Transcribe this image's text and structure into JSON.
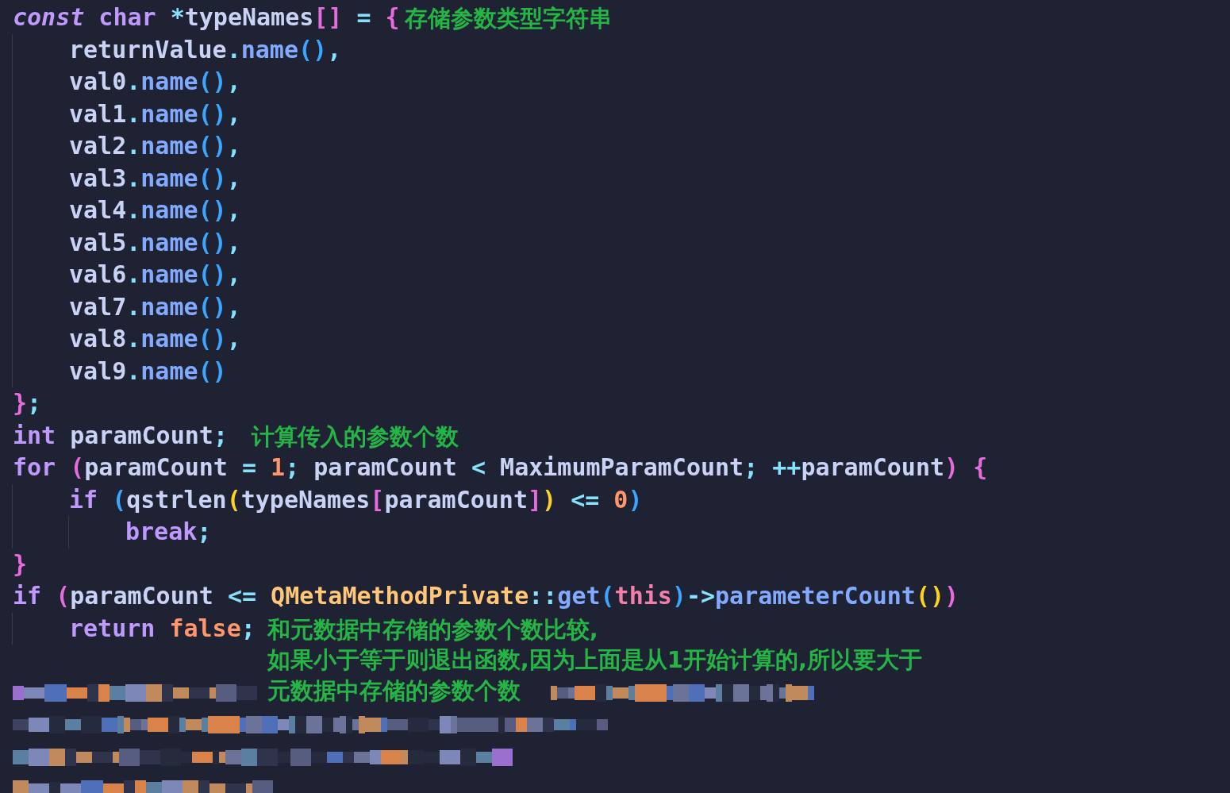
{
  "editor": {
    "lines": [
      {
        "tokens": [
          {
            "kind": "storage",
            "text": "const"
          },
          {
            "kind": "keyword",
            "text": " char"
          },
          {
            "kind": "op",
            "text": " *"
          },
          {
            "kind": "plain",
            "text": "typeNames"
          },
          {
            "kind": "bracket1",
            "text": "[]"
          },
          {
            "kind": "op",
            "text": " ="
          },
          {
            "kind": "bracket1",
            "text": " {"
          }
        ],
        "note": [
          "存储参数类型字符串"
        ],
        "children": [
          {
            "tokens": [
              {
                "kind": "plain",
                "text": "returnValue"
              },
              {
                "kind": "op",
                "text": "."
              },
              {
                "kind": "func",
                "text": "name"
              },
              {
                "kind": "bracket2",
                "text": "()"
              },
              {
                "kind": "op",
                "text": ","
              }
            ]
          },
          {
            "tokens": [
              {
                "kind": "plain",
                "text": "val0"
              },
              {
                "kind": "op",
                "text": "."
              },
              {
                "kind": "func",
                "text": "name"
              },
              {
                "kind": "bracket2",
                "text": "()"
              },
              {
                "kind": "op",
                "text": ","
              }
            ]
          },
          {
            "tokens": [
              {
                "kind": "plain",
                "text": "val1"
              },
              {
                "kind": "op",
                "text": "."
              },
              {
                "kind": "func",
                "text": "name"
              },
              {
                "kind": "bracket2",
                "text": "()"
              },
              {
                "kind": "op",
                "text": ","
              }
            ]
          },
          {
            "tokens": [
              {
                "kind": "plain",
                "text": "val2"
              },
              {
                "kind": "op",
                "text": "."
              },
              {
                "kind": "func",
                "text": "name"
              },
              {
                "kind": "bracket2",
                "text": "()"
              },
              {
                "kind": "op",
                "text": ","
              }
            ]
          },
          {
            "tokens": [
              {
                "kind": "plain",
                "text": "val3"
              },
              {
                "kind": "op",
                "text": "."
              },
              {
                "kind": "func",
                "text": "name"
              },
              {
                "kind": "bracket2",
                "text": "()"
              },
              {
                "kind": "op",
                "text": ","
              }
            ]
          },
          {
            "tokens": [
              {
                "kind": "plain",
                "text": "val4"
              },
              {
                "kind": "op",
                "text": "."
              },
              {
                "kind": "func",
                "text": "name"
              },
              {
                "kind": "bracket2",
                "text": "()"
              },
              {
                "kind": "op",
                "text": ","
              }
            ]
          },
          {
            "tokens": [
              {
                "kind": "plain",
                "text": "val5"
              },
              {
                "kind": "op",
                "text": "."
              },
              {
                "kind": "func",
                "text": "name"
              },
              {
                "kind": "bracket2",
                "text": "()"
              },
              {
                "kind": "op",
                "text": ","
              }
            ]
          },
          {
            "tokens": [
              {
                "kind": "plain",
                "text": "val6"
              },
              {
                "kind": "op",
                "text": "."
              },
              {
                "kind": "func",
                "text": "name"
              },
              {
                "kind": "bracket2",
                "text": "()"
              },
              {
                "kind": "op",
                "text": ","
              }
            ]
          },
          {
            "tokens": [
              {
                "kind": "plain",
                "text": "val7"
              },
              {
                "kind": "op",
                "text": "."
              },
              {
                "kind": "func",
                "text": "name"
              },
              {
                "kind": "bracket2",
                "text": "()"
              },
              {
                "kind": "op",
                "text": ","
              }
            ]
          },
          {
            "tokens": [
              {
                "kind": "plain",
                "text": "val8"
              },
              {
                "kind": "op",
                "text": "."
              },
              {
                "kind": "func",
                "text": "name"
              },
              {
                "kind": "bracket2",
                "text": "()"
              },
              {
                "kind": "op",
                "text": ","
              }
            ]
          },
          {
            "tokens": [
              {
                "kind": "plain",
                "text": "val9"
              },
              {
                "kind": "op",
                "text": "."
              },
              {
                "kind": "func",
                "text": "name"
              },
              {
                "kind": "bracket2",
                "text": "()"
              }
            ]
          }
        ]
      },
      {
        "tokens": [
          {
            "kind": "bracket1",
            "text": "}"
          },
          {
            "kind": "op",
            "text": ";"
          }
        ]
      },
      {
        "tokens": [
          {
            "kind": "keyword",
            "text": "int"
          },
          {
            "kind": "plain",
            "text": " paramCount"
          },
          {
            "kind": "op",
            "text": ";"
          }
        ],
        "note": [
          "计算传入的参数个数"
        ]
      },
      {
        "tokens": [
          {
            "kind": "keyword",
            "text": "for"
          },
          {
            "kind": "bracket1",
            "text": " ("
          },
          {
            "kind": "plain",
            "text": "paramCount"
          },
          {
            "kind": "op",
            "text": " ="
          },
          {
            "kind": "number",
            "text": " 1"
          },
          {
            "kind": "op",
            "text": ";"
          },
          {
            "kind": "plain",
            "text": " paramCount"
          },
          {
            "kind": "op",
            "text": " <"
          },
          {
            "kind": "plain",
            "text": " MaximumParamCount"
          },
          {
            "kind": "op",
            "text": ";"
          },
          {
            "kind": "op",
            "text": " ++"
          },
          {
            "kind": "plain",
            "text": "paramCount"
          },
          {
            "kind": "bracket1",
            "text": ")"
          },
          {
            "kind": "bracket1",
            "text": " {"
          }
        ],
        "children": [
          {
            "tokens": [
              {
                "kind": "keyword",
                "text": "if"
              },
              {
                "kind": "bracket2",
                "text": " ("
              },
              {
                "kind": "plain",
                "text": "qstrlen"
              },
              {
                "kind": "bracket3",
                "text": "("
              },
              {
                "kind": "plain",
                "text": "typeNames"
              },
              {
                "kind": "bracket1",
                "text": "["
              },
              {
                "kind": "plain",
                "text": "paramCount"
              },
              {
                "kind": "bracket1",
                "text": "]"
              },
              {
                "kind": "bracket3",
                "text": ")"
              },
              {
                "kind": "op",
                "text": " <="
              },
              {
                "kind": "number",
                "text": " 0"
              },
              {
                "kind": "bracket2",
                "text": ")"
              }
            ],
            "children": [
              {
                "tokens": [
                  {
                    "kind": "keyword",
                    "text": "break"
                  },
                  {
                    "kind": "op",
                    "text": ";"
                  }
                ]
              }
            ]
          }
        ]
      },
      {
        "tokens": [
          {
            "kind": "bracket1",
            "text": "}"
          }
        ]
      },
      {
        "tokens": [
          {
            "kind": "keyword",
            "text": "if"
          },
          {
            "kind": "bracket1",
            "text": " ("
          },
          {
            "kind": "plain",
            "text": "paramCount"
          },
          {
            "kind": "op",
            "text": " <="
          },
          {
            "kind": "class",
            "text": " QMetaMethodPrivate"
          },
          {
            "kind": "op",
            "text": "::"
          },
          {
            "kind": "func",
            "text": "get"
          },
          {
            "kind": "bracket2",
            "text": "("
          },
          {
            "kind": "this",
            "text": "this"
          },
          {
            "kind": "bracket2",
            "text": ")"
          },
          {
            "kind": "op",
            "text": "->"
          },
          {
            "kind": "func",
            "text": "parameterCount"
          },
          {
            "kind": "bracket3",
            "text": "()"
          },
          {
            "kind": "bracket1",
            "text": ")"
          }
        ],
        "children": [
          {
            "tokens": [
              {
                "kind": "keyword",
                "text": "return"
              },
              {
                "kind": "number",
                "text": " false"
              },
              {
                "kind": "op",
                "text": ";"
              }
            ],
            "note": [
              "和元数据中存储的参数个数比较,",
              "如果小于等于则退出函数,因为上面是从1开始计算的,所以要大于",
              "元数据中存储的参数个数"
            ]
          }
        ]
      }
    ]
  }
}
